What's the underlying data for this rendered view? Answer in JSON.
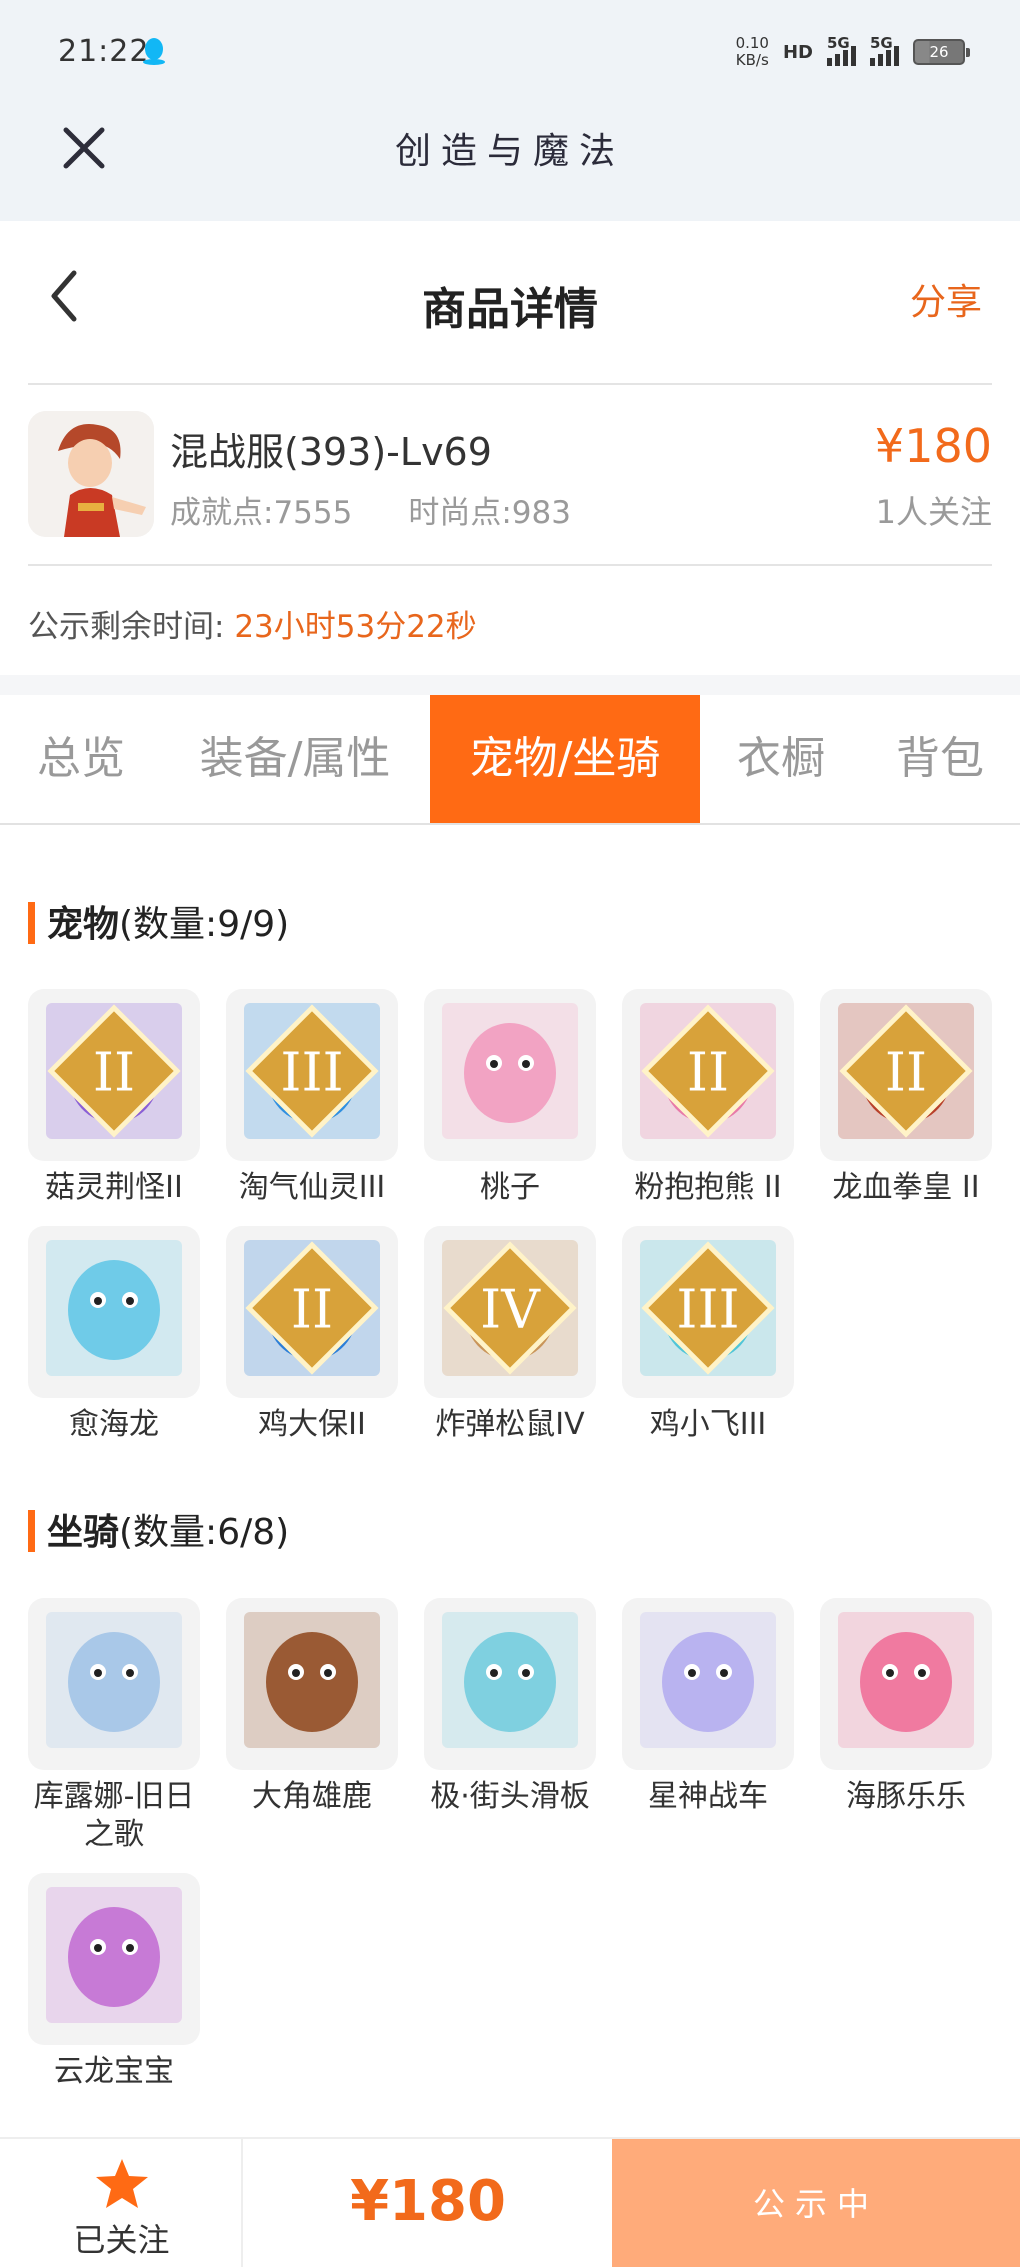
{
  "status_bar": {
    "time": "21:22",
    "net_speed_value": "0.10",
    "net_speed_unit": "KB/s",
    "hd": "HD",
    "sim1": "5G",
    "sim2": "5G",
    "battery": "26"
  },
  "app_bar": {
    "title": "创造与魔法"
  },
  "page_header": {
    "title": "商品详情",
    "share": "分享"
  },
  "product": {
    "name": "混战服(393)-Lv69",
    "achievement": "成就点:7555",
    "fashion": "时尚点:983",
    "price": "¥180",
    "followers": "1人关注",
    "countdown_label": "公示剩余时间:",
    "countdown_value": "23小时53分22秒"
  },
  "tabs": [
    "总览",
    "装备/属性",
    "宠物/坐骑",
    "衣橱",
    "背包"
  ],
  "active_tab": 2,
  "pets": {
    "title": "宠物",
    "count": "(数量:9/9)",
    "items": [
      {
        "name": "菇灵荆怪II",
        "rank": "II",
        "color": "#8a5fd6"
      },
      {
        "name": "淘气仙灵III",
        "rank": "III",
        "color": "#2f8fe0"
      },
      {
        "name": "桃子",
        "rank": "",
        "color": "#f2a3c3"
      },
      {
        "name": "粉抱抱熊 II",
        "rank": "II",
        "color": "#e87aa8"
      },
      {
        "name": "龙血拳皇 II",
        "rank": "II",
        "color": "#b8402a"
      },
      {
        "name": "愈海龙",
        "rank": "",
        "color": "#6fcbe8"
      },
      {
        "name": "鸡大保II",
        "rank": "II",
        "color": "#2b7ed8"
      },
      {
        "name": "炸弹松鼠IV",
        "rank": "IV",
        "color": "#c9955a"
      },
      {
        "name": "鸡小飞III",
        "rank": "III",
        "color": "#4fc5d8"
      }
    ]
  },
  "mounts": {
    "title": "坐骑",
    "count": "(数量:6/8)",
    "items": [
      {
        "name": "库露娜-旧日之歌",
        "rank": "",
        "color": "#a9c8e8"
      },
      {
        "name": "大角雄鹿",
        "rank": "",
        "color": "#9a5a34"
      },
      {
        "name": "极·街头滑板",
        "rank": "",
        "color": "#7fd0e0"
      },
      {
        "name": "星神战车",
        "rank": "",
        "color": "#b9b3f0"
      },
      {
        "name": "海豚乐乐",
        "rank": "",
        "color": "#f07aa0"
      },
      {
        "name": "云龙宝宝",
        "rank": "",
        "color": "#c77ad6"
      }
    ]
  },
  "bottom_bar": {
    "follow_label": "已关注",
    "price": "¥180",
    "status": "公示中"
  },
  "colors": {
    "accent": "#ff6a14",
    "price": "#f26a1b",
    "status_button": "#ffab7a"
  }
}
